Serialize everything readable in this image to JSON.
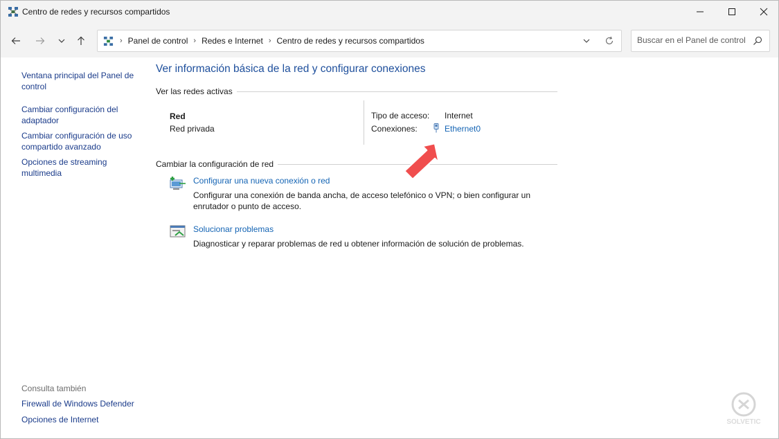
{
  "window": {
    "title": "Centro de redes y recursos compartidos"
  },
  "address": {
    "crumbs": [
      "Panel de control",
      "Redes e Internet",
      "Centro de redes y recursos compartidos"
    ]
  },
  "search": {
    "placeholder": "Buscar en el Panel de control"
  },
  "sidebar": {
    "links": [
      "Ventana principal del Panel de control",
      "Cambiar configuración del adaptador",
      "Cambiar configuración de uso compartido avanzado",
      "Opciones de streaming multimedia"
    ],
    "see_also_title": "Consulta también",
    "see_also": [
      "Firewall de Windows Defender",
      "Opciones de Internet"
    ]
  },
  "main": {
    "title": "Ver información básica de la red y configurar conexiones",
    "active_networks_heading": "Ver las redes activas",
    "network": {
      "name": "Red",
      "category": "Red privada",
      "access_type_label": "Tipo de acceso:",
      "access_type_value": "Internet",
      "connections_label": "Conexiones:",
      "connection_name": "Ethernet0"
    },
    "change_heading": "Cambiar la configuración de red",
    "tasks": [
      {
        "title": "Configurar una nueva conexión o red",
        "description": "Configurar una conexión de banda ancha, de acceso telefónico o VPN; o bien configurar un enrutador o punto de acceso."
      },
      {
        "title": "Solucionar problemas",
        "description": "Diagnosticar y reparar problemas de red u obtener información de solución de problemas."
      }
    ]
  },
  "colors": {
    "link": "#1464b4",
    "title_blue": "#1e4f9c",
    "annotation_arrow": "#f04e4e"
  },
  "watermark": {
    "text": "SOLVETIC"
  }
}
